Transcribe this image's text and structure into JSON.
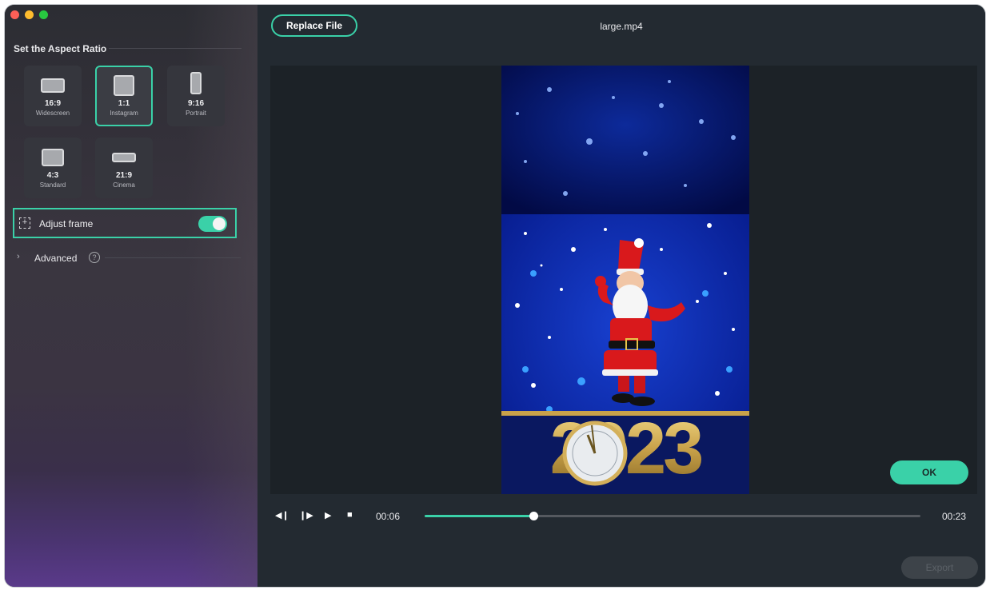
{
  "window": {
    "traffic_lights": [
      "close",
      "minimize",
      "zoom"
    ]
  },
  "sidebar": {
    "section_title": "Set the Aspect Ratio",
    "ratios": [
      {
        "value": "16:9",
        "label": "Widescreen",
        "selected": false
      },
      {
        "value": "1:1",
        "label": "Instagram",
        "selected": true
      },
      {
        "value": "9:16",
        "label": "Portrait",
        "selected": false
      },
      {
        "value": "4:3",
        "label": "Standard",
        "selected": false
      },
      {
        "value": "21:9",
        "label": "Cinema",
        "selected": false
      }
    ],
    "adjust_frame": {
      "label": "Adjust frame",
      "enabled": true
    },
    "advanced": {
      "label": "Advanced",
      "help": "?"
    }
  },
  "header": {
    "replace_label": "Replace File",
    "file_name": "large.mp4"
  },
  "preview": {
    "video_text": "2023"
  },
  "actions": {
    "ok_label": "OK",
    "export_label": "Export"
  },
  "playback": {
    "current_time": "00:06",
    "total_time": "00:23",
    "progress": 0.22
  },
  "colors": {
    "accent": "#3ad1a8",
    "background": "#232a31"
  }
}
